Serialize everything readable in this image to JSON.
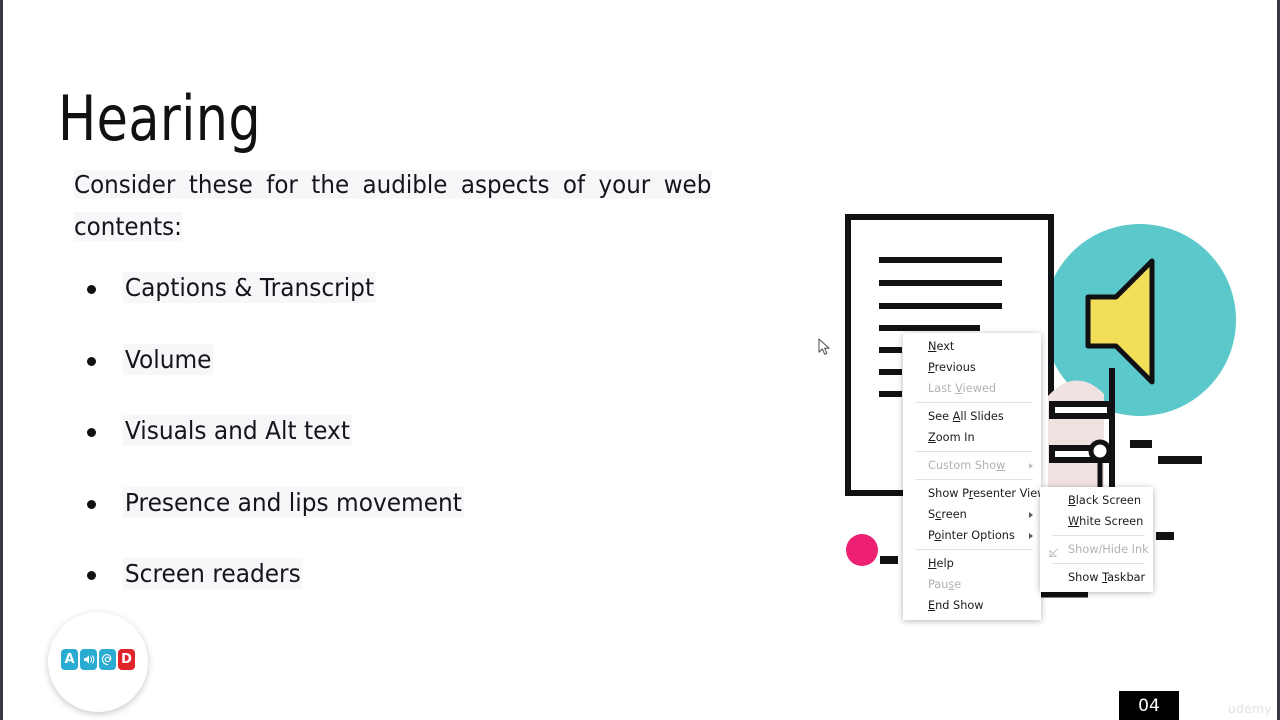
{
  "slide": {
    "title": "Hearing",
    "intro": "Consider these for the audible aspects of your web contents:",
    "bullets": [
      "Captions & Transcript",
      "Volume",
      "Visuals and Alt text",
      "Presence and lips movement",
      "Screen readers"
    ],
    "page_number": "04",
    "watermark": "udemy"
  },
  "logo": {
    "tiles": [
      {
        "glyph": "A",
        "color": "#29ABD2"
      },
      {
        "glyph": "◂))",
        "color": "#29ABD2"
      },
      {
        "glyph": "@",
        "color": "#29ABD2"
      },
      {
        "glyph": "D",
        "color": "#E0252B"
      }
    ],
    "subtitle": "· · · · · · · · · · · · · · · · · · · ·"
  },
  "context_menu": {
    "items": [
      {
        "label": "Next",
        "accel": "N",
        "disabled": false,
        "submenu": false
      },
      {
        "label": "Previous",
        "accel": "P",
        "disabled": false,
        "submenu": false
      },
      {
        "label": "Last Viewed",
        "accel": "V",
        "disabled": true,
        "submenu": false
      },
      {
        "separator": true
      },
      {
        "label": "See All Slides",
        "accel": "A",
        "disabled": false,
        "submenu": false
      },
      {
        "label": "Zoom In",
        "accel": "Z",
        "disabled": false,
        "submenu": false
      },
      {
        "separator": true
      },
      {
        "label": "Custom Show",
        "accel": "w",
        "disabled": true,
        "submenu": true
      },
      {
        "separator": true
      },
      {
        "label": "Show Presenter View",
        "accel": "r",
        "disabled": false,
        "submenu": false
      },
      {
        "label": "Screen",
        "accel": "c",
        "disabled": false,
        "submenu": true
      },
      {
        "label": "Pointer Options",
        "accel": "o",
        "disabled": false,
        "submenu": true
      },
      {
        "separator": true
      },
      {
        "label": "Help",
        "accel": "H",
        "disabled": false,
        "submenu": false
      },
      {
        "label": "Pause",
        "accel": "s",
        "disabled": true,
        "submenu": false
      },
      {
        "label": "End Show",
        "accel": "E",
        "disabled": false,
        "submenu": false
      }
    ]
  },
  "screen_submenu": {
    "items": [
      {
        "label": "Black Screen",
        "accel": "B",
        "disabled": false,
        "icon": ""
      },
      {
        "label": "White Screen",
        "accel": "W",
        "disabled": false,
        "icon": ""
      },
      {
        "separator": true
      },
      {
        "label": "Show/Hide Ink",
        "accel": "",
        "disabled": true,
        "icon": "ink-crossed-icon"
      },
      {
        "separator": true
      },
      {
        "label": "Show Taskbar",
        "accel": "T",
        "disabled": false,
        "icon": ""
      }
    ]
  },
  "illustration": {
    "colors": {
      "teal_bubble": "#5BC8CB",
      "speaker_yellow": "#F2DE58",
      "pink_dot": "#EE2073",
      "figure_pink": "#F1E2E2",
      "outline": "#111114"
    },
    "document_lines_long": 4,
    "document_lines_short": 3
  }
}
